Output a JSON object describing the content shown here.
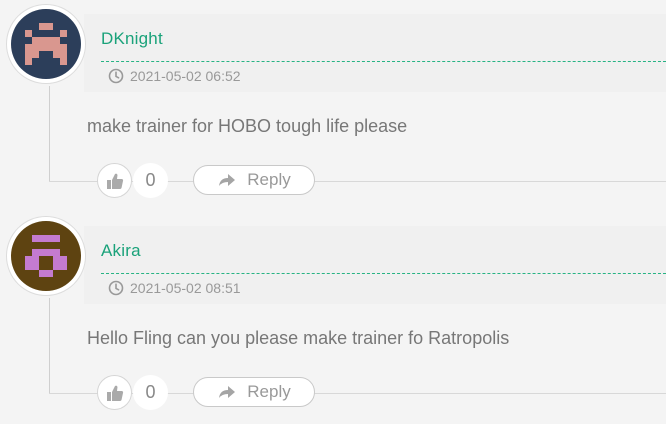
{
  "comments": [
    {
      "author": "DKnight",
      "timestamp": "2021-05-02 06:52",
      "text": "make trainer for HOBO tough life please",
      "likes": "0",
      "reply_label": "Reply",
      "avatar_colors": {
        "bg": "#2c3e5a",
        "fg": "#d9978f"
      }
    },
    {
      "author": "Akira",
      "timestamp": "2021-05-02 08:51",
      "text": "Hello Fling can you please make trainer fo Ratropolis",
      "likes": "0",
      "reply_label": "Reply",
      "avatar_colors": {
        "bg": "#5e4311",
        "fg": "#c47bd0"
      }
    }
  ],
  "icons": {
    "clock": "clock-icon",
    "like": "thumbs-up-icon",
    "reply": "reply-arrow-icon"
  },
  "colors": {
    "accent": "#1aa27a",
    "text": "#777777",
    "muted": "#999999",
    "background": "#f4f4f4"
  }
}
